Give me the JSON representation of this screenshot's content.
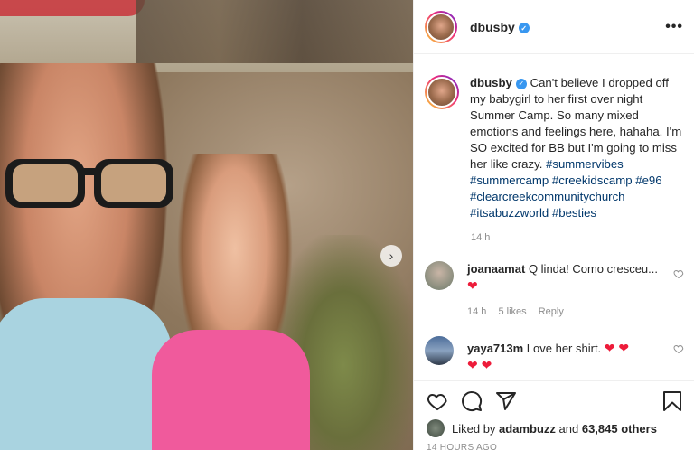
{
  "post": {
    "username": "dbusby",
    "verified_mark": "✓",
    "more_label": "•••",
    "next_arrow": "›",
    "caption_before": "Can't believe I dropped off my babygirl to her first over night Summer Camp. So many mixed emotions and feelings here, hahaha. I'm SO excited for BB but I'm going to miss her like crazy. ",
    "hashtags": [
      "#summervibes",
      "#summercamp",
      "#creekidscamp",
      "#e96",
      "#clearcreekcommunitychurch",
      "#itsabuzzworld",
      "#besties"
    ],
    "caption_time": "14 h"
  },
  "comments": [
    {
      "username": "joanaamat",
      "text": "Q linda! Como cresceu...",
      "emoji": "❤",
      "time": "14 h",
      "likes": "5 likes",
      "reply": "Reply",
      "avatar_color": "#9aa89a"
    },
    {
      "username": "yaya713m",
      "text": "Love her shirt.",
      "emoji": "❤ ❤",
      "emoji2": "❤ ❤",
      "avatar_color": "#5d7da8"
    }
  ],
  "actions": {
    "liked_by_prefix": "Liked by",
    "liked_by_user": "adambuzz",
    "and_word": "and",
    "others_count": "63,845 others",
    "date": "14 HOURS AGO"
  },
  "icons": {
    "like": "heart-icon",
    "comment": "comment-icon",
    "share": "share-icon",
    "save": "bookmark-icon",
    "comment_like": "small-heart-icon"
  }
}
